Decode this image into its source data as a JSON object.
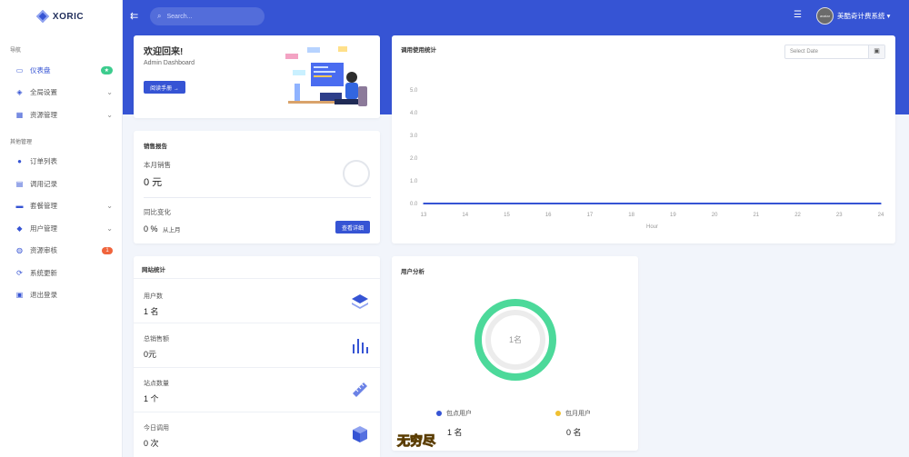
{
  "sidebar": {
    "logo": "XORIC",
    "sections": [
      "导航",
      "其他管理"
    ],
    "items": [
      {
        "label": "仪表盘",
        "badge": "★",
        "badge_color": "#3dcc8e",
        "icon": "monitor-icon",
        "glyph": "▭",
        "active": true,
        "chev": false
      },
      {
        "label": "全局设置",
        "icon": "layers-icon",
        "glyph": "◈",
        "chev": true
      },
      {
        "label": "资源管理",
        "icon": "grid-icon",
        "glyph": "▦",
        "chev": true
      },
      {
        "label": "订单列表",
        "icon": "circle-icon",
        "glyph": "●",
        "chev": false
      },
      {
        "label": "调用记录",
        "icon": "document-icon",
        "glyph": "▤",
        "chev": false
      },
      {
        "label": "套餐管理",
        "icon": "toggle-icon",
        "glyph": "▬",
        "chev": true
      },
      {
        "label": "用户管理",
        "icon": "user-icon",
        "glyph": "◆",
        "chev": true
      },
      {
        "label": "资源审核",
        "badge": "1",
        "badge_color": "#f0643c",
        "icon": "audit-icon",
        "glyph": "◍",
        "chev": false
      },
      {
        "label": "系统更新",
        "icon": "refresh-icon",
        "glyph": "⟳",
        "chev": false
      },
      {
        "label": "退出登录",
        "icon": "logout-icon",
        "glyph": "▣",
        "chev": false
      }
    ]
  },
  "topbar": {
    "search_placeholder": "Search...",
    "user_name": "美酷奇计费系统",
    "avatar_text": "avatar",
    "accent": "#3654d4"
  },
  "welcome": {
    "title": "欢迎回来!",
    "subtitle": "Admin Dashboard",
    "button": "阅读手册 →"
  },
  "sales": {
    "title": "销售报告",
    "month_label": "本月销售",
    "month_value": "0 元",
    "yoy_label": "同比变化",
    "yoy_value": "0 %",
    "yoy_suffix": "从上月",
    "detail_button": "查看详细"
  },
  "site_stats": {
    "title": "网站统计",
    "rows": [
      {
        "label": "用户数",
        "value": "1 名",
        "icon": "stack-icon"
      },
      {
        "label": "总销售额",
        "value": "0元",
        "icon": "bars-icon"
      },
      {
        "label": "站点数量",
        "value": "1 个",
        "icon": "ruler-icon"
      },
      {
        "label": "今日调用",
        "value": "0 次",
        "icon": "cube-icon"
      }
    ]
  },
  "usage_chart": {
    "title": "调用使用统计",
    "date_placeholder": "Select Date"
  },
  "chart_data": {
    "type": "line",
    "title": "调用使用统计",
    "xlabel": "Hour",
    "ylabel": "",
    "x": [
      13,
      14,
      15,
      16,
      17,
      18,
      19,
      20,
      21,
      22,
      23,
      24
    ],
    "yticks": [
      "0.0",
      "1.0",
      "2.0",
      "3.0",
      "4.0",
      "5.0"
    ],
    "ylim": [
      0,
      5
    ],
    "series": [
      {
        "values": [
          0,
          0,
          0,
          0,
          0,
          0,
          0,
          0,
          0,
          0,
          0,
          0
        ],
        "color": "#3654d4"
      }
    ]
  },
  "user_analysis": {
    "title": "用户分析",
    "center_text": "1名",
    "ring_color": "#4cd99a",
    "legend": [
      {
        "label": "包点用户",
        "value": "1 名",
        "color": "#3654d4"
      },
      {
        "label": "包月用户",
        "value": "0 名",
        "color": "#f0c030"
      }
    ]
  },
  "overlay": {
    "watermark": "无穷尽"
  }
}
